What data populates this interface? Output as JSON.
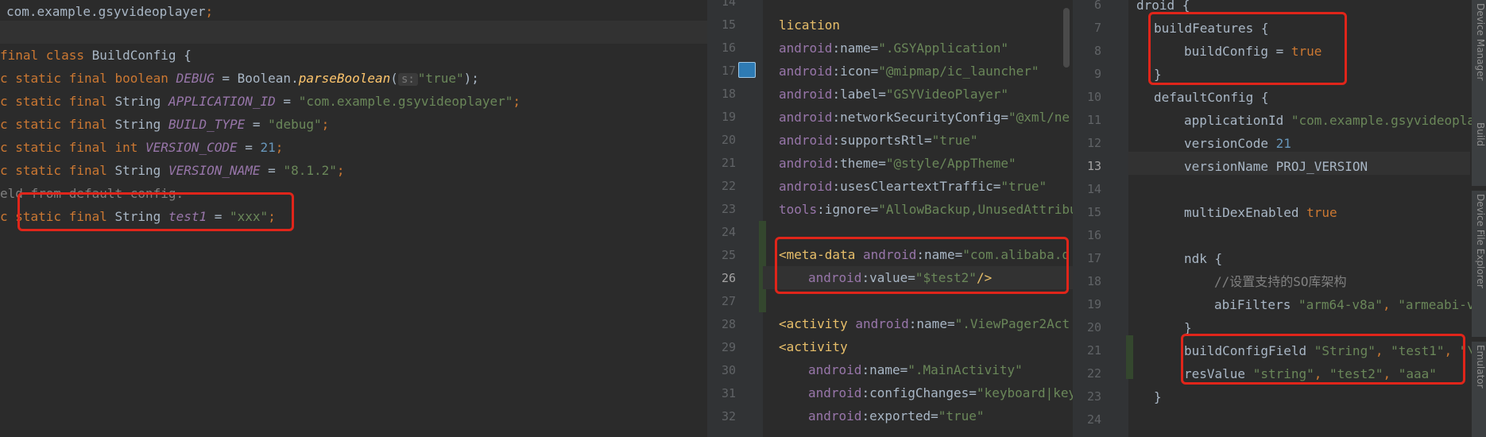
{
  "pane1": {
    "package_name": "com.example.gsyvideoplayer",
    "class_decl": "final class BuildConfig {",
    "debug_hint": "s:",
    "field_comment": "eld from default config.",
    "fields": [
      {
        "prefix": "c static final ",
        "type": "boolean",
        "name": "DEBUG",
        "eq": " = Boolean.",
        "call": "parseBoolean",
        "rest_value": "\"true\"",
        "rest": ");"
      },
      {
        "prefix": "c static final ",
        "type": "String",
        "name": "APPLICATION_ID",
        "value": "\"com.example.gsyvideoplayer\""
      },
      {
        "prefix": "c static final ",
        "type": "String",
        "name": "BUILD_TYPE",
        "value": "\"debug\""
      },
      {
        "prefix": "c static final ",
        "type": "int",
        "name": "VERSION_CODE",
        "value": "21"
      },
      {
        "prefix": "c static final ",
        "type": "String",
        "name": "VERSION_NAME",
        "value": "\"8.1.2\""
      },
      {
        "prefix": "c static final ",
        "type": "String",
        "name": "test1",
        "value": "\"xxx\""
      }
    ]
  },
  "pane2": {
    "line_numbers": [
      "14",
      "15",
      "16",
      "17",
      "18",
      "19",
      "20",
      "21",
      "22",
      "23",
      "24",
      "25",
      "26",
      "27",
      "28",
      "29",
      "30",
      "31",
      "32"
    ],
    "current_line": "26",
    "application_tail": "lication",
    "attrs": [
      {
        "ns": "android",
        "attr": ":name=",
        "val": "\".GSYApplication\""
      },
      {
        "ns": "android",
        "attr": ":icon=",
        "val": "\"@mipmap/ic_launcher\""
      },
      {
        "ns": "android",
        "attr": ":label=",
        "val": "\"GSYVideoPlayer\""
      },
      {
        "ns": "android",
        "attr": ":networkSecurityConfig=",
        "val": "\"@xml/ne"
      },
      {
        "ns": "android",
        "attr": ":supportsRtl=",
        "val": "\"true\""
      },
      {
        "ns": "android",
        "attr": ":theme=",
        "val": "\"@style/AppTheme\""
      },
      {
        "ns": "android",
        "attr": ":usesCleartextTraffic=",
        "val": "\"true\""
      },
      {
        "ns": "tools",
        "attr": ":ignore=",
        "val": "\"AllowBackup,UnusedAttribu"
      }
    ],
    "meta_tag": "<meta-data",
    "meta_name_val": "\"com.alibaba.q",
    "meta_value_val": "\"$test2\"",
    "meta_close": "/>",
    "activity1_tag": "<activity",
    "activity1_name_val": "\".ViewPager2Act",
    "activity2_tag": "<activity",
    "act2_attrs": [
      {
        "ns": "android",
        "attr": ":name=",
        "val": "\".MainActivity\""
      },
      {
        "ns": "android",
        "attr": ":configChanges=",
        "val": "\"keyboard|key"
      },
      {
        "ns": "android",
        "attr": ":exported=",
        "val": "\"true\""
      }
    ]
  },
  "pane3": {
    "line_numbers": [
      "6",
      "7",
      "8",
      "9",
      "10",
      "11",
      "12",
      "13",
      "14",
      "15",
      "16",
      "17",
      "18",
      "19",
      "20",
      "21",
      "22",
      "23",
      "24"
    ],
    "current_line": "13",
    "droid_line": "droid {",
    "buildFeatures": "buildFeatures {",
    "buildConfig_key": "buildConfig",
    "buildConfig_val": "true",
    "close_brace": "}",
    "defaultConfig": "defaultConfig {",
    "applicationId_key": "applicationId",
    "applicationId_val": "\"com.example.gsyvideoplay",
    "versionCode_key": "versionCode",
    "versionCode_val": "21",
    "versionName_line": "versionName PROJ_VERSION",
    "multiDex_key": "multiDexEnabled",
    "multiDex_val": "true",
    "ndk": "ndk {",
    "comment": "//设置支持的SO库架构",
    "abiFilters_key": "abiFilters",
    "abi_v1": "\"arm64-v8a\"",
    "abi_v2": "\"armeabi-v7",
    "bcf_key": "buildConfigField",
    "bcf_v1": "\"String\"",
    "bcf_v2": "\"test1\"",
    "bcf_v3": "\"\\",
    "res_key": "resValue",
    "res_v1": "\"string\"",
    "res_v2": "\"test2\"",
    "res_v3": "\"aaa\"",
    "side_tabs": [
      "Device Manager",
      "Build",
      "Device File Explorer",
      "Emulator"
    ]
  }
}
